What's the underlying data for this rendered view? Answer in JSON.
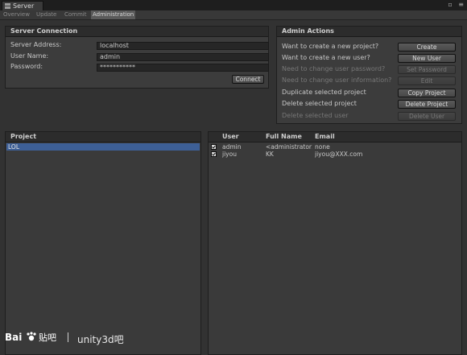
{
  "window": {
    "title": "Server"
  },
  "tabs": [
    {
      "label": "Overview",
      "active": false
    },
    {
      "label": "Update",
      "active": false
    },
    {
      "label": "Commit",
      "active": false
    },
    {
      "label": "Administration",
      "active": true
    }
  ],
  "server_connection": {
    "title": "Server Connection",
    "address_label": "Server Address:",
    "address_value": "localhost",
    "user_label": "User Name:",
    "user_value": "admin",
    "password_label": "Password:",
    "password_value": "***********",
    "connect_label": "Connect"
  },
  "admin_actions": {
    "title": "Admin Actions",
    "rows": [
      {
        "label": "Want to create a new project?",
        "button": "Create",
        "enabled": true
      },
      {
        "label": "Want to create a new user?",
        "button": "New User",
        "enabled": true
      },
      {
        "label": "Need to change user password?",
        "button": "Set Password",
        "enabled": false
      },
      {
        "label": "Need to change user information?",
        "button": "Edit",
        "enabled": false
      },
      {
        "label": "Duplicate selected project",
        "button": "Copy Project",
        "enabled": true
      },
      {
        "label": "Delete selected project",
        "button": "Delete Project",
        "enabled": true
      },
      {
        "label": "Delete selected user",
        "button": "Delete User",
        "enabled": false
      }
    ]
  },
  "projects": {
    "title": "Project",
    "items": [
      "LOL"
    ],
    "selected_index": 0
  },
  "users": {
    "columns": {
      "user": "User",
      "full_name": "Full Name",
      "email": "Email"
    },
    "rows": [
      {
        "checked": true,
        "user": "admin",
        "full_name": "<administrator>",
        "email": "none"
      },
      {
        "checked": true,
        "user": "jiyou",
        "full_name": "KK",
        "email": "jiyou@XXX.com"
      }
    ]
  },
  "watermark": {
    "text": "unity3d吧"
  }
}
